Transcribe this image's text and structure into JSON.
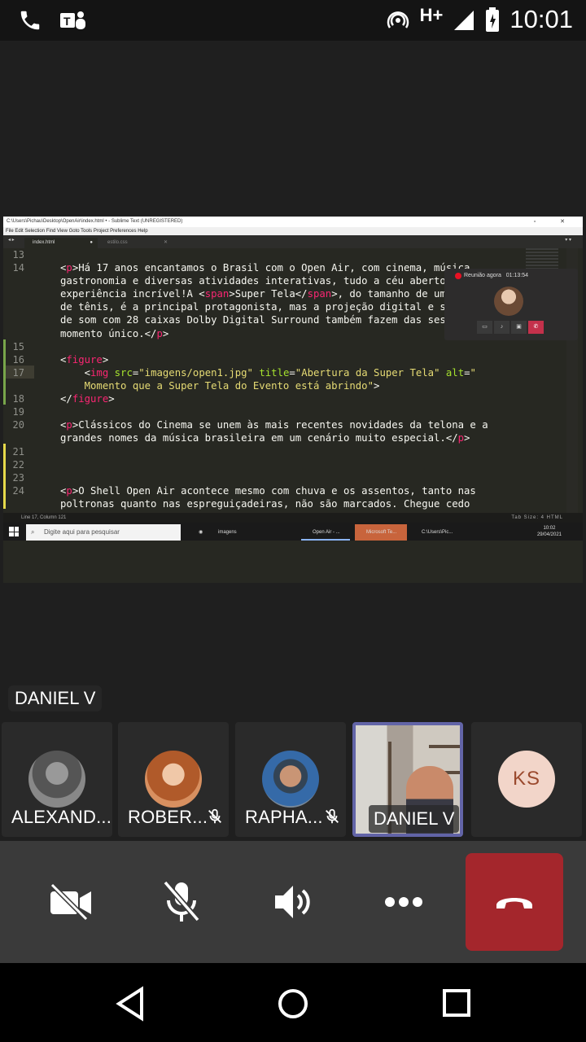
{
  "status_bar": {
    "network": "H+",
    "time": "10:01"
  },
  "screen_share": {
    "window_title": "C:\\Users\\Pichau\\Desktop\\OpenAir\\index.html • - Sublime Text (UNREGISTERED)",
    "menu": "File  Edit  Selection  Find  View  Goto  Tools  Project  Preferences  Help",
    "tabs": [
      "index.html",
      "estilo.css"
    ],
    "line_numbers": [
      "13",
      "14",
      "15",
      "16",
      "17",
      "18",
      "19",
      "20",
      "21",
      "22",
      "23",
      "24"
    ],
    "status_left": "Line 17, Column 121",
    "status_right": "Tab Size: 4        HTML",
    "taskbar_search": "Digite aqui para pesquisar",
    "taskbar_items": [
      "imagens",
      "Open Air - ...",
      "Microsoft Te...",
      "C:\\Users\\Pic..."
    ],
    "taskbar_time": "10:02",
    "taskbar_date": "29/04/2021"
  },
  "pip": {
    "label": "Reunião agora",
    "timer": "01:13:54"
  },
  "active_speaker": "DANIEL V",
  "participants": [
    {
      "name": "ALEXAND...",
      "muted": false
    },
    {
      "name": "ROBER...",
      "muted": true
    },
    {
      "name": "RAPHA...",
      "muted": true
    },
    {
      "name": "DANIEL V",
      "muted": false,
      "video": true
    },
    {
      "initials": "KS"
    }
  ],
  "controls": [
    "camera-off",
    "mic-off",
    "speaker",
    "more",
    "hang-up"
  ],
  "colors": {
    "accent": "#6264a7",
    "end_call": "#a4262c",
    "tag": "#f92672",
    "attr": "#a6e22e",
    "string": "#e6db74"
  }
}
